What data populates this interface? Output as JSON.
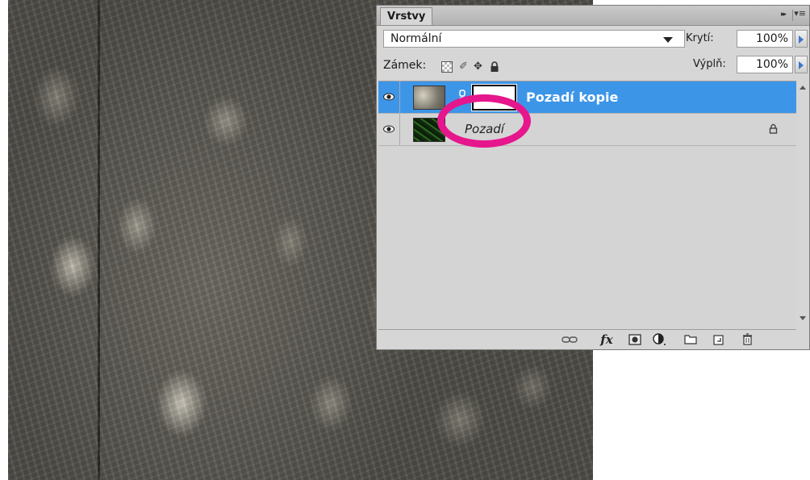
{
  "panel": {
    "tab_label": "Vrstvy",
    "collapse_glyph": "▸▸",
    "menu_glyph": "▾≡"
  },
  "blend_mode": {
    "value": "Normální"
  },
  "opacity": {
    "label": "Krytí:",
    "value": "100%"
  },
  "fill": {
    "label": "Výplň:",
    "value": "100%"
  },
  "lock": {
    "label": "Zámek:"
  },
  "layers": [
    {
      "name": "Pozadí kopie",
      "selected": true,
      "has_mask": true
    },
    {
      "name": "Pozadí",
      "selected": false,
      "locked": true
    }
  ],
  "bottom_tools": {
    "fx_label": "fx"
  },
  "colors": {
    "selection": "#3d95e8",
    "annotation": "#e6168c",
    "panel_bg": "#d6d6d6"
  }
}
